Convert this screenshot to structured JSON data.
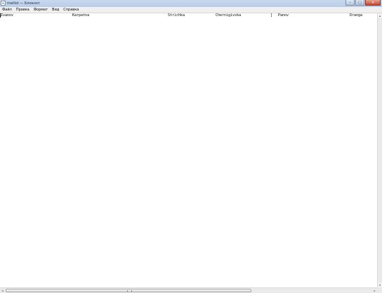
{
  "window": {
    "title": "mailist — Блокнот",
    "icon": "notepad-icon",
    "buttons": {
      "minimize_glyph": "–",
      "maximize_glyph": "□",
      "close_glyph": "✕"
    }
  },
  "menubar": {
    "items": [
      {
        "label": "Файл"
      },
      {
        "label": "Правка"
      },
      {
        "label": "Формат"
      },
      {
        "label": "Вид"
      },
      {
        "label": "Справка"
      }
    ]
  },
  "document": {
    "line1": {
      "cells": [
        "Ivanov",
        "Karpatna",
        "Strichka",
        "Chernigivska",
        "[",
        "Panov",
        "Dranga"
      ]
    }
  },
  "scrollbars": {
    "left_arrow": "◂",
    "right_arrow": "▸",
    "up_arrow": "▴",
    "down_arrow": "▾"
  }
}
